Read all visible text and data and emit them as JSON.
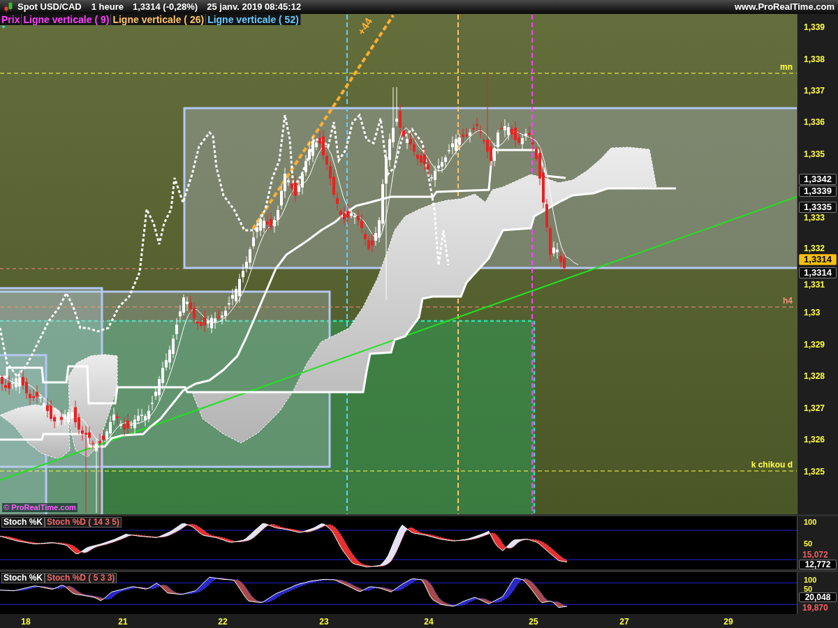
{
  "header": {
    "instrument": "Spot USD/CAD",
    "timeframe": "1 heure",
    "last_price": "1,3314 (-0,28%)",
    "datetime": "25 janv. 2019 08:45:12",
    "website": "www.ProRealTime.com"
  },
  "price_chart": {
    "legend": [
      {
        "label": "Prix",
        "kind": "price",
        "color": "#ff40ff"
      },
      {
        "label": "Ligne verticale ( 9)",
        "kind": "vertical_line",
        "color": "#ff40ff"
      },
      {
        "label": "Ligne verticale ( 26)",
        "kind": "vertical_line",
        "color": "#ffc468"
      },
      {
        "label": "Ligne verticale ( 52)",
        "kind": "vertical_line",
        "color": "#66ccff"
      }
    ],
    "projection_label": "+44",
    "level_labels": [
      {
        "label": "mn",
        "color": "#ffff40"
      },
      {
        "label": "h4",
        "color": "#f4907c"
      },
      {
        "label": "k chikou d",
        "color": "#ffff40"
      }
    ],
    "watermark": "© ProRealTime.com",
    "price_axis": [
      "1,339",
      "1,338",
      "1,337",
      "1,336",
      "1,335",
      "1,333",
      "1,332",
      "1,331",
      "1,33",
      "1,329",
      "1,328",
      "1,327",
      "1,326",
      "1,325"
    ],
    "price_tags": [
      {
        "value": "1,3342",
        "kind": "level"
      },
      {
        "value": "1,3339",
        "kind": "level"
      },
      {
        "value": "1,3335",
        "kind": "level"
      },
      {
        "value": "1,3314",
        "kind": "current"
      },
      {
        "value": "1,3314",
        "kind": "level"
      }
    ]
  },
  "stochastic_panels": [
    {
      "k_label": "Stoch %K",
      "d_label": "Stoch %D ( 14 3 5)",
      "axis": [
        "100",
        "50"
      ],
      "readings": [
        {
          "value": "15,072",
          "kind": "d"
        },
        {
          "value": "12,772",
          "kind": "k"
        }
      ]
    },
    {
      "k_label": "Stoch %K",
      "d_label": "Stoch %D ( 5 3 3)",
      "axis": [
        "100",
        "50"
      ],
      "readings": [
        {
          "value": "20,048",
          "kind": "k"
        },
        {
          "value": "19,870",
          "kind": "d"
        }
      ]
    }
  ],
  "time_axis": [
    "18",
    "21",
    "22",
    "23",
    "24",
    "25",
    "27",
    "29"
  ]
}
